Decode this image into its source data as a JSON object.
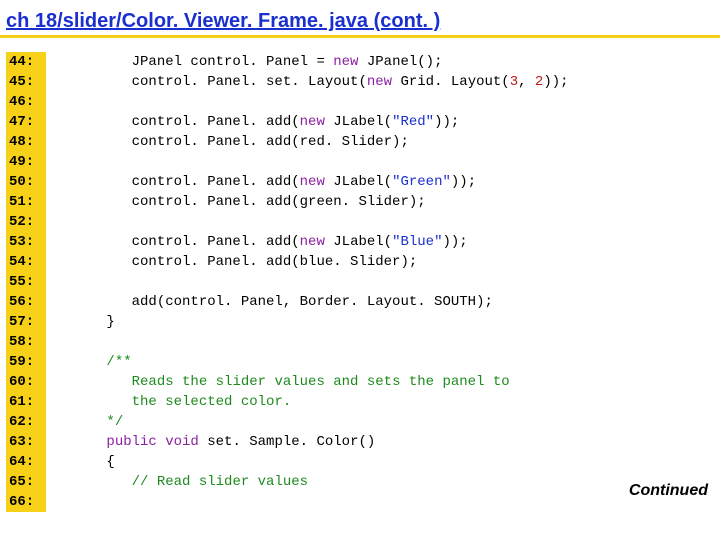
{
  "title": "ch 18/slider/Color. Viewer. Frame. java  (cont. )",
  "continued": "Continued",
  "line_start": 44,
  "line_end": 66,
  "code": [
    {
      "indent": 3,
      "tokens": [
        {
          "t": "plain",
          "v": "JPanel control. Panel = "
        },
        {
          "t": "kw",
          "v": "new"
        },
        {
          "t": "plain",
          "v": " JPanel();"
        }
      ]
    },
    {
      "indent": 3,
      "tokens": [
        {
          "t": "plain",
          "v": "control. Panel. set. Layout("
        },
        {
          "t": "kw",
          "v": "new"
        },
        {
          "t": "plain",
          "v": " Grid. Layout("
        },
        {
          "t": "num",
          "v": "3"
        },
        {
          "t": "plain",
          "v": ", "
        },
        {
          "t": "num",
          "v": "2"
        },
        {
          "t": "plain",
          "v": "));"
        }
      ]
    },
    {
      "indent": 0,
      "tokens": []
    },
    {
      "indent": 3,
      "tokens": [
        {
          "t": "plain",
          "v": "control. Panel. add("
        },
        {
          "t": "kw",
          "v": "new"
        },
        {
          "t": "plain",
          "v": " JLabel("
        },
        {
          "t": "str",
          "v": "\"Red\""
        },
        {
          "t": "plain",
          "v": "));"
        }
      ]
    },
    {
      "indent": 3,
      "tokens": [
        {
          "t": "plain",
          "v": "control. Panel. add(red. Slider);"
        }
      ]
    },
    {
      "indent": 0,
      "tokens": []
    },
    {
      "indent": 3,
      "tokens": [
        {
          "t": "plain",
          "v": "control. Panel. add("
        },
        {
          "t": "kw",
          "v": "new"
        },
        {
          "t": "plain",
          "v": " JLabel("
        },
        {
          "t": "str",
          "v": "\"Green\""
        },
        {
          "t": "plain",
          "v": "));"
        }
      ]
    },
    {
      "indent": 3,
      "tokens": [
        {
          "t": "plain",
          "v": "control. Panel. add(green. Slider);"
        }
      ]
    },
    {
      "indent": 0,
      "tokens": []
    },
    {
      "indent": 3,
      "tokens": [
        {
          "t": "plain",
          "v": "control. Panel. add("
        },
        {
          "t": "kw",
          "v": "new"
        },
        {
          "t": "plain",
          "v": " JLabel("
        },
        {
          "t": "str",
          "v": "\"Blue\""
        },
        {
          "t": "plain",
          "v": "));"
        }
      ]
    },
    {
      "indent": 3,
      "tokens": [
        {
          "t": "plain",
          "v": "control. Panel. add(blue. Slider);"
        }
      ]
    },
    {
      "indent": 0,
      "tokens": []
    },
    {
      "indent": 3,
      "tokens": [
        {
          "t": "plain",
          "v": "add(control. Panel, Border. Layout. SOUTH);"
        }
      ]
    },
    {
      "indent": 2,
      "tokens": [
        {
          "t": "plain",
          "v": "}"
        }
      ]
    },
    {
      "indent": 0,
      "tokens": []
    },
    {
      "indent": 2,
      "tokens": [
        {
          "t": "cmt",
          "v": "/**"
        }
      ]
    },
    {
      "indent": 3,
      "tokens": [
        {
          "t": "cmt",
          "v": "Reads the slider values and sets the panel to"
        }
      ]
    },
    {
      "indent": 3,
      "tokens": [
        {
          "t": "cmt",
          "v": "the selected color."
        }
      ]
    },
    {
      "indent": 2,
      "tokens": [
        {
          "t": "cmt",
          "v": "*/"
        }
      ]
    },
    {
      "indent": 2,
      "tokens": [
        {
          "t": "kw",
          "v": "public void"
        },
        {
          "t": "plain",
          "v": " set. Sample. Color()"
        }
      ]
    },
    {
      "indent": 2,
      "tokens": [
        {
          "t": "plain",
          "v": "{"
        }
      ]
    },
    {
      "indent": 3,
      "tokens": [
        {
          "t": "cmt",
          "v": "// Read slider values"
        }
      ]
    },
    {
      "indent": 0,
      "tokens": []
    }
  ]
}
